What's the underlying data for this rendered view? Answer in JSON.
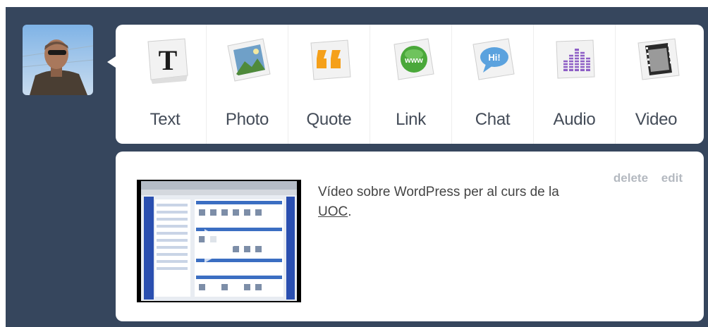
{
  "post_types": [
    {
      "id": "text",
      "label": "Text",
      "icon": "text-icon"
    },
    {
      "id": "photo",
      "label": "Photo",
      "icon": "photo-icon"
    },
    {
      "id": "quote",
      "label": "Quote",
      "icon": "quote-icon"
    },
    {
      "id": "link",
      "label": "Link",
      "icon": "link-icon"
    },
    {
      "id": "chat",
      "label": "Chat",
      "icon": "chat-icon"
    },
    {
      "id": "audio",
      "label": "Audio",
      "icon": "audio-icon"
    },
    {
      "id": "video",
      "label": "Video",
      "icon": "video-icon"
    }
  ],
  "icon_text": {
    "text": "T",
    "quote": "“",
    "link": "www",
    "chat": "Hi!"
  },
  "post": {
    "controls": {
      "delete": "delete",
      "edit": "edit"
    },
    "caption_prefix": "Vídeo sobre WordPress per al curs de la ",
    "caption_link": "UOC",
    "caption_suffix": "."
  },
  "colors": {
    "dashboard_bg": "#36465d",
    "quote_orange": "#f5a01a",
    "link_green": "#4aa83a",
    "chat_blue": "#5ba2de",
    "audio_purple": "#8e5fc6"
  }
}
